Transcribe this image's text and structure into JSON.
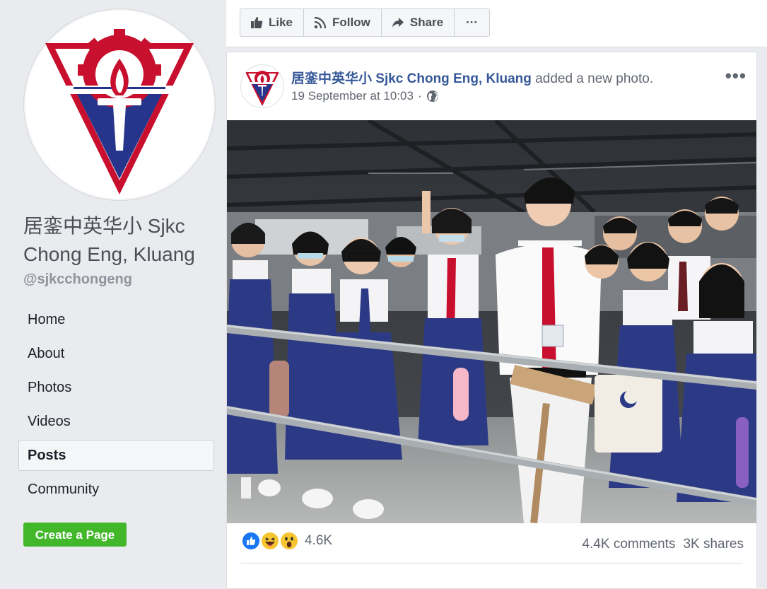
{
  "page": {
    "name": "居銮中英华小 Sjkc Chong Eng, Kluang",
    "handle": "@sjkcchongeng"
  },
  "nav": {
    "items": [
      {
        "label": "Home"
      },
      {
        "label": "About"
      },
      {
        "label": "Photos"
      },
      {
        "label": "Videos"
      },
      {
        "label": "Posts",
        "active": true
      },
      {
        "label": "Community"
      }
    ]
  },
  "create_page": {
    "label": "Create a Page"
  },
  "action_bar": {
    "like": "Like",
    "follow": "Follow",
    "share": "Share",
    "more": "···"
  },
  "post": {
    "author": "居銮中英华小 Sjkc Chong Eng, Kluang",
    "action": "added a new photo.",
    "timestamp": "19 September at 10:03",
    "separator": "·",
    "audience_icon": "globe-icon",
    "more": "•••",
    "reaction_count": "4.6K",
    "reactions": [
      "like-reaction-icon",
      "haha-reaction-icon",
      "wow-reaction-icon"
    ],
    "comments": "4.4K comments",
    "shares": "3K shares"
  },
  "colors": {
    "link_blue": "#365899",
    "create_green": "#42b72a",
    "logo_red": "#c8102e",
    "logo_blue": "#27348b",
    "background": "#e9ebee"
  }
}
